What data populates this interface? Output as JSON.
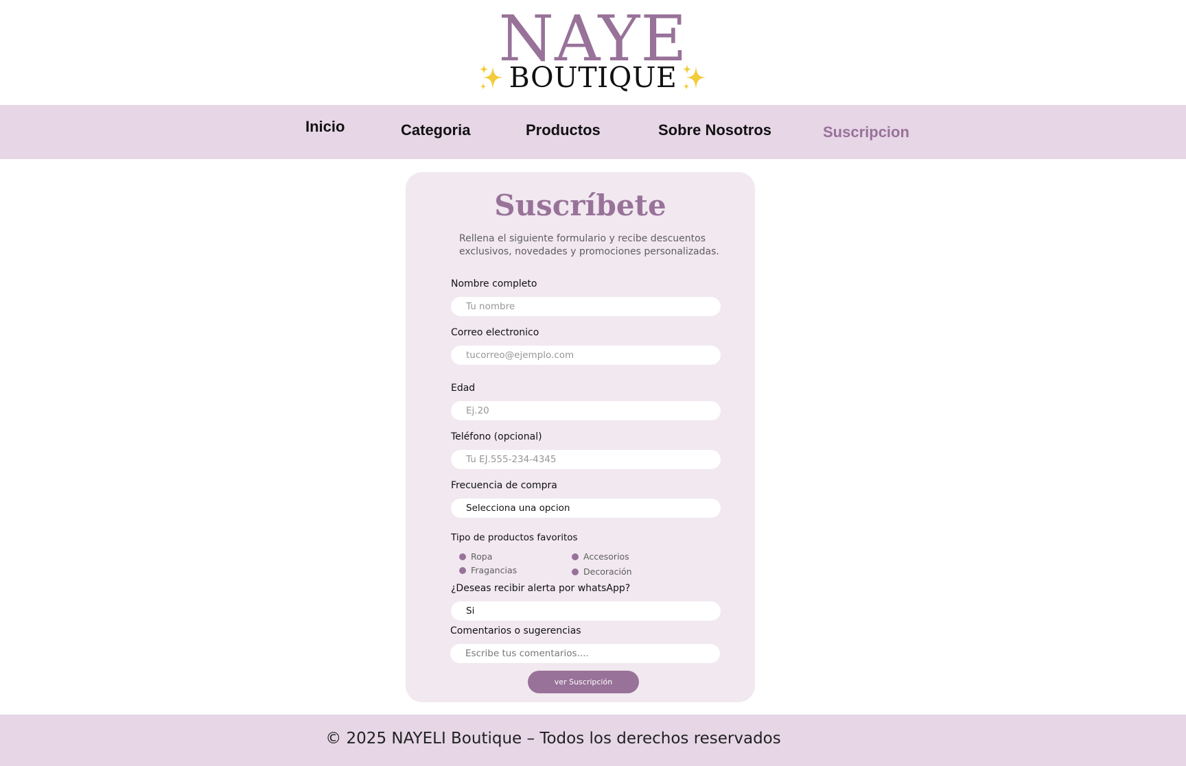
{
  "brand": {
    "name": "NAYE",
    "subtitle": "BOUTIQUE",
    "accent_color": "#987299",
    "sparkle_color": "#f3cc3c"
  },
  "nav": {
    "items": [
      {
        "label": "Inicio"
      },
      {
        "label": "Categoria"
      },
      {
        "label": "Productos"
      },
      {
        "label": "Sobre Nosotros"
      },
      {
        "label": "Suscripcion",
        "active": true
      }
    ],
    "background": "#e6d6e6"
  },
  "form": {
    "title": "Suscríbete",
    "description": "Rellena el siguiente formulario y recibe descuentos exclusivos, novedades y promociones personalizadas.",
    "name": {
      "label": "Nombre completo",
      "placeholder": "Tu nombre"
    },
    "email": {
      "label": "Correo electronico",
      "placeholder": "tucorreo@ejemplo.com"
    },
    "age": {
      "label": "Edad",
      "placeholder": "Ej.20"
    },
    "phone": {
      "label": "Teléfono (opcional)",
      "placeholder": "Tu EJ.555-234-4345"
    },
    "frequency": {
      "label": "Frecuencia de compra",
      "value": "Selecciona una opcion"
    },
    "favorites": {
      "label": "Tipo de productos favoritos",
      "options": [
        "Ropa",
        "Accesorios",
        "Fragancias",
        "Decoración"
      ]
    },
    "whatsapp": {
      "label": "¿Deseas recibir alerta por whatsApp?",
      "value": "Si"
    },
    "comments": {
      "label": "Comentarios o sugerencias",
      "placeholder": "Escribe tus comentarios...."
    },
    "submit_label": "ver Suscripción",
    "card_background": "#f1e8f0"
  },
  "footer": {
    "text": "© 2025 NAYELI Boutique – Todos los derechos reservados"
  }
}
